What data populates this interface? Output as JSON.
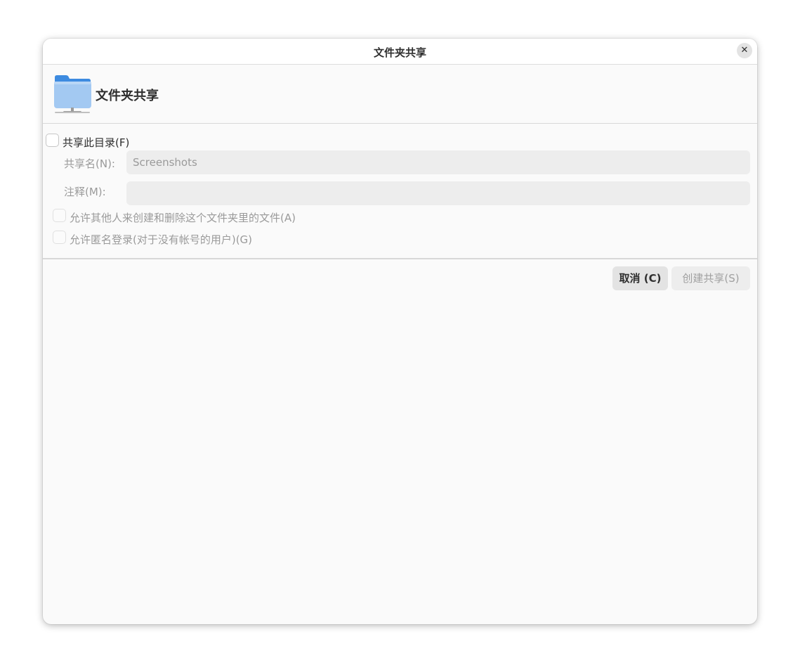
{
  "window": {
    "title": "文件夹共享",
    "close_icon": "close-icon"
  },
  "header": {
    "icon": "folder-share-icon",
    "title": "文件夹共享"
  },
  "form": {
    "share_checkbox_label": "共享此目录(F)",
    "share_checkbox_checked": false,
    "share_name_label": "共享名(N):",
    "share_name_value": "Screenshots",
    "comment_label": "注释(M):",
    "comment_value": "",
    "allow_write_label": "允许其他人来创建和删除这个文件夹里的文件(A)",
    "allow_write_checked": false,
    "allow_guest_label": "允许匿名登录(对于没有帐号的用户)(G)",
    "allow_guest_checked": false
  },
  "buttons": {
    "cancel_label": "取消 (C)",
    "create_label": "创建共享(S)"
  },
  "colors": {
    "folder_blue": "#3d8be0",
    "folder_light_blue": "#a3c9f2",
    "window_bg": "#fafafa"
  }
}
